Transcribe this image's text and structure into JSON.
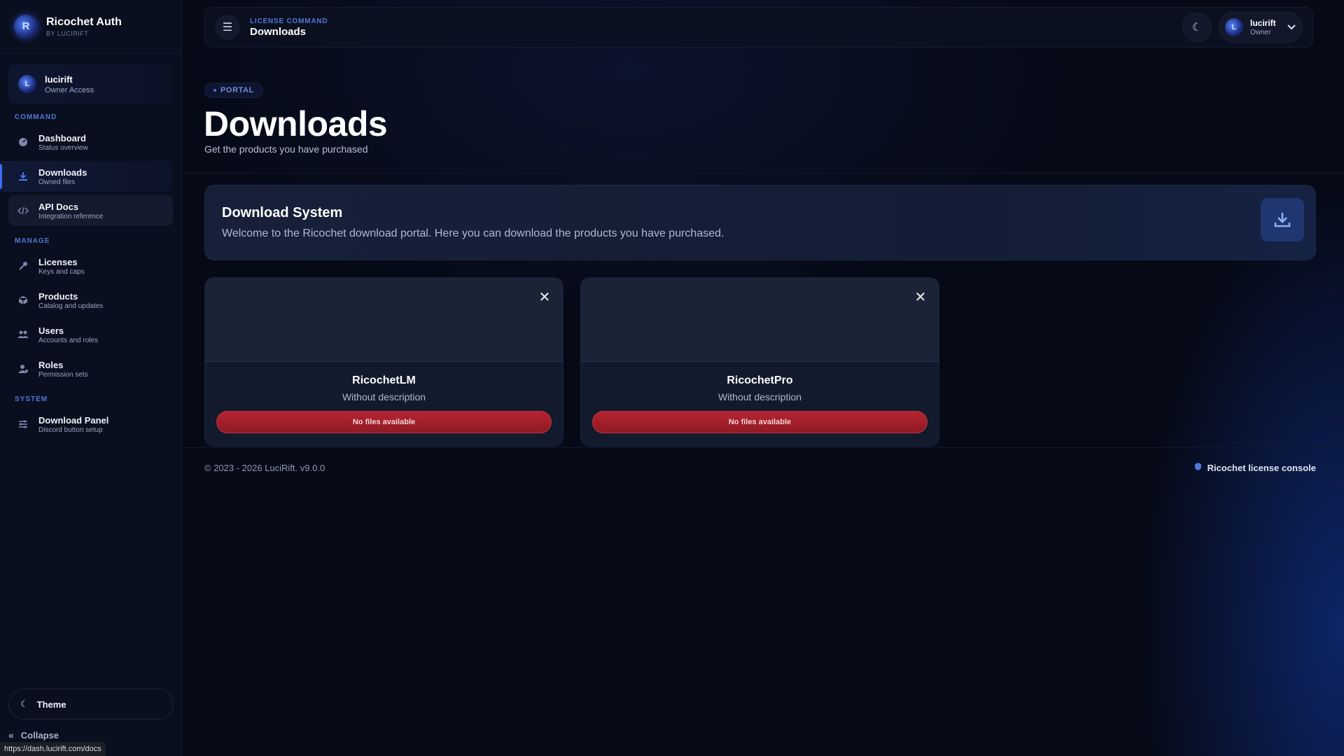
{
  "brand": {
    "title": "Ricochet Auth",
    "subtitle": "BY LUCIRIFT"
  },
  "user": {
    "name": "lucirift",
    "role": "Owner Access"
  },
  "sidebar": {
    "sections": {
      "command": "COMMAND",
      "manage": "MANAGE",
      "system": "SYSTEM"
    },
    "items": [
      {
        "title": "Dashboard",
        "sub": "Status overview",
        "icon": "dashboard-icon"
      },
      {
        "title": "Downloads",
        "sub": "Owned files",
        "icon": "download-icon"
      },
      {
        "title": "API Docs",
        "sub": "Integration reference",
        "icon": "code-icon"
      },
      {
        "title": "Licenses",
        "sub": "Keys and caps",
        "icon": "key-icon"
      },
      {
        "title": "Products",
        "sub": "Catalog and updates",
        "icon": "box-icon"
      },
      {
        "title": "Users",
        "sub": "Accounts and roles",
        "icon": "users-icon"
      },
      {
        "title": "Roles",
        "sub": "Permission sets",
        "icon": "role-icon"
      },
      {
        "title": "Download Panel",
        "sub": "Discord button setup",
        "icon": "sliders-icon"
      }
    ],
    "theme_label": "Theme",
    "collapse_label": "Collapse"
  },
  "status_url": "https://dash.lucirift.com/docs",
  "topbar": {
    "crumb_top": "LICENSE COMMAND",
    "crumb_title": "Downloads",
    "account_name": "lucirift",
    "account_role": "Owner"
  },
  "header": {
    "badge": "PORTAL",
    "title": "Downloads",
    "subtitle": "Get the products you have purchased"
  },
  "info": {
    "title": "Download System",
    "text": "Welcome to the Ricochet download portal. Here you can download the products you have purchased."
  },
  "products": [
    {
      "name": "RicochetLM",
      "description": "Without description",
      "button": "No files available"
    },
    {
      "name": "RicochetPro",
      "description": "Without description",
      "button": "No files available"
    }
  ],
  "footer": {
    "copyright": "© 2023 - 2026 LuciRift. v9.0.0",
    "console": "Ricochet license console"
  },
  "colors": {
    "accent": "#3d6cf0",
    "danger": "#b42430",
    "background": "#060a17"
  }
}
